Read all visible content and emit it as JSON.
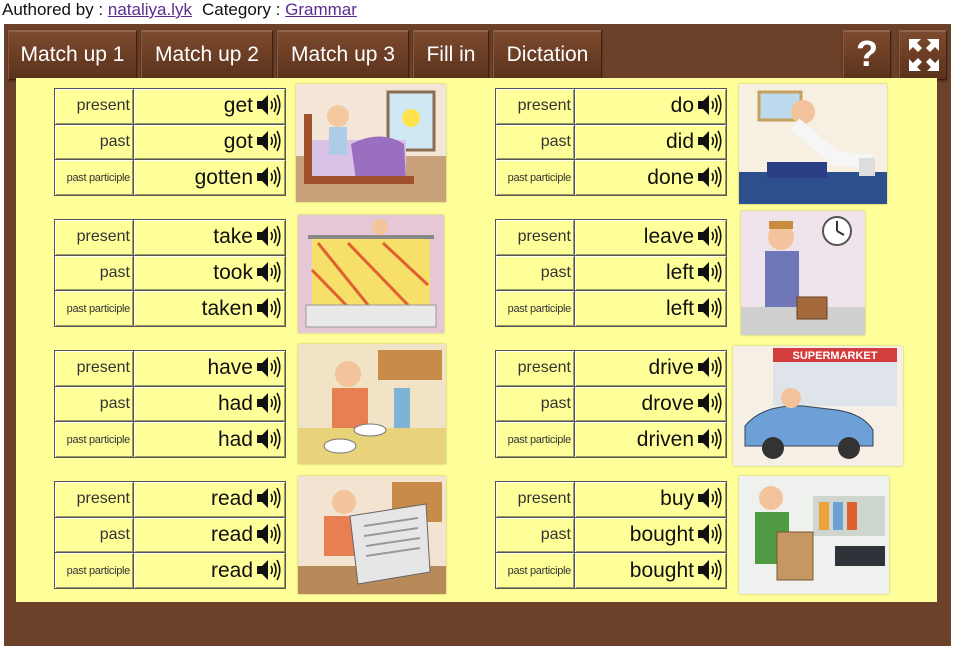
{
  "meta": {
    "authored_prefix": "Authored by :",
    "author": "nataliya.lyk",
    "category_prefix": "Category :",
    "category": "Grammar"
  },
  "toolbar": {
    "buttons": [
      "Match up 1",
      "Match up 2",
      "Match up 3",
      "Fill in",
      "Dictation"
    ],
    "help_label": "?",
    "fullscreen_icon": "fullscreen-icon"
  },
  "labels": {
    "present": "present",
    "past": "past",
    "past_participle": "past participle"
  },
  "verbs": [
    {
      "present": "get",
      "past": "got",
      "past_participle": "gotten"
    },
    {
      "present": "do",
      "past": "did",
      "past_participle": "done"
    },
    {
      "present": "take",
      "past": "took",
      "past_participle": "taken"
    },
    {
      "present": "leave",
      "past": "left",
      "past_participle": "left"
    },
    {
      "present": "have",
      "past": "had",
      "past_participle": "had"
    },
    {
      "present": "drive",
      "past": "drove",
      "past_participle": "driven"
    },
    {
      "present": "read",
      "past": "read",
      "past_participle": "read"
    },
    {
      "present": "buy",
      "past": "bought",
      "past_participle": "bought"
    }
  ],
  "picture_text": {
    "supermarket_sign": "SUPERMARKET"
  },
  "colors": {
    "frame": "#6b4129",
    "board": "#ffff99",
    "link": "#5b2d90"
  }
}
